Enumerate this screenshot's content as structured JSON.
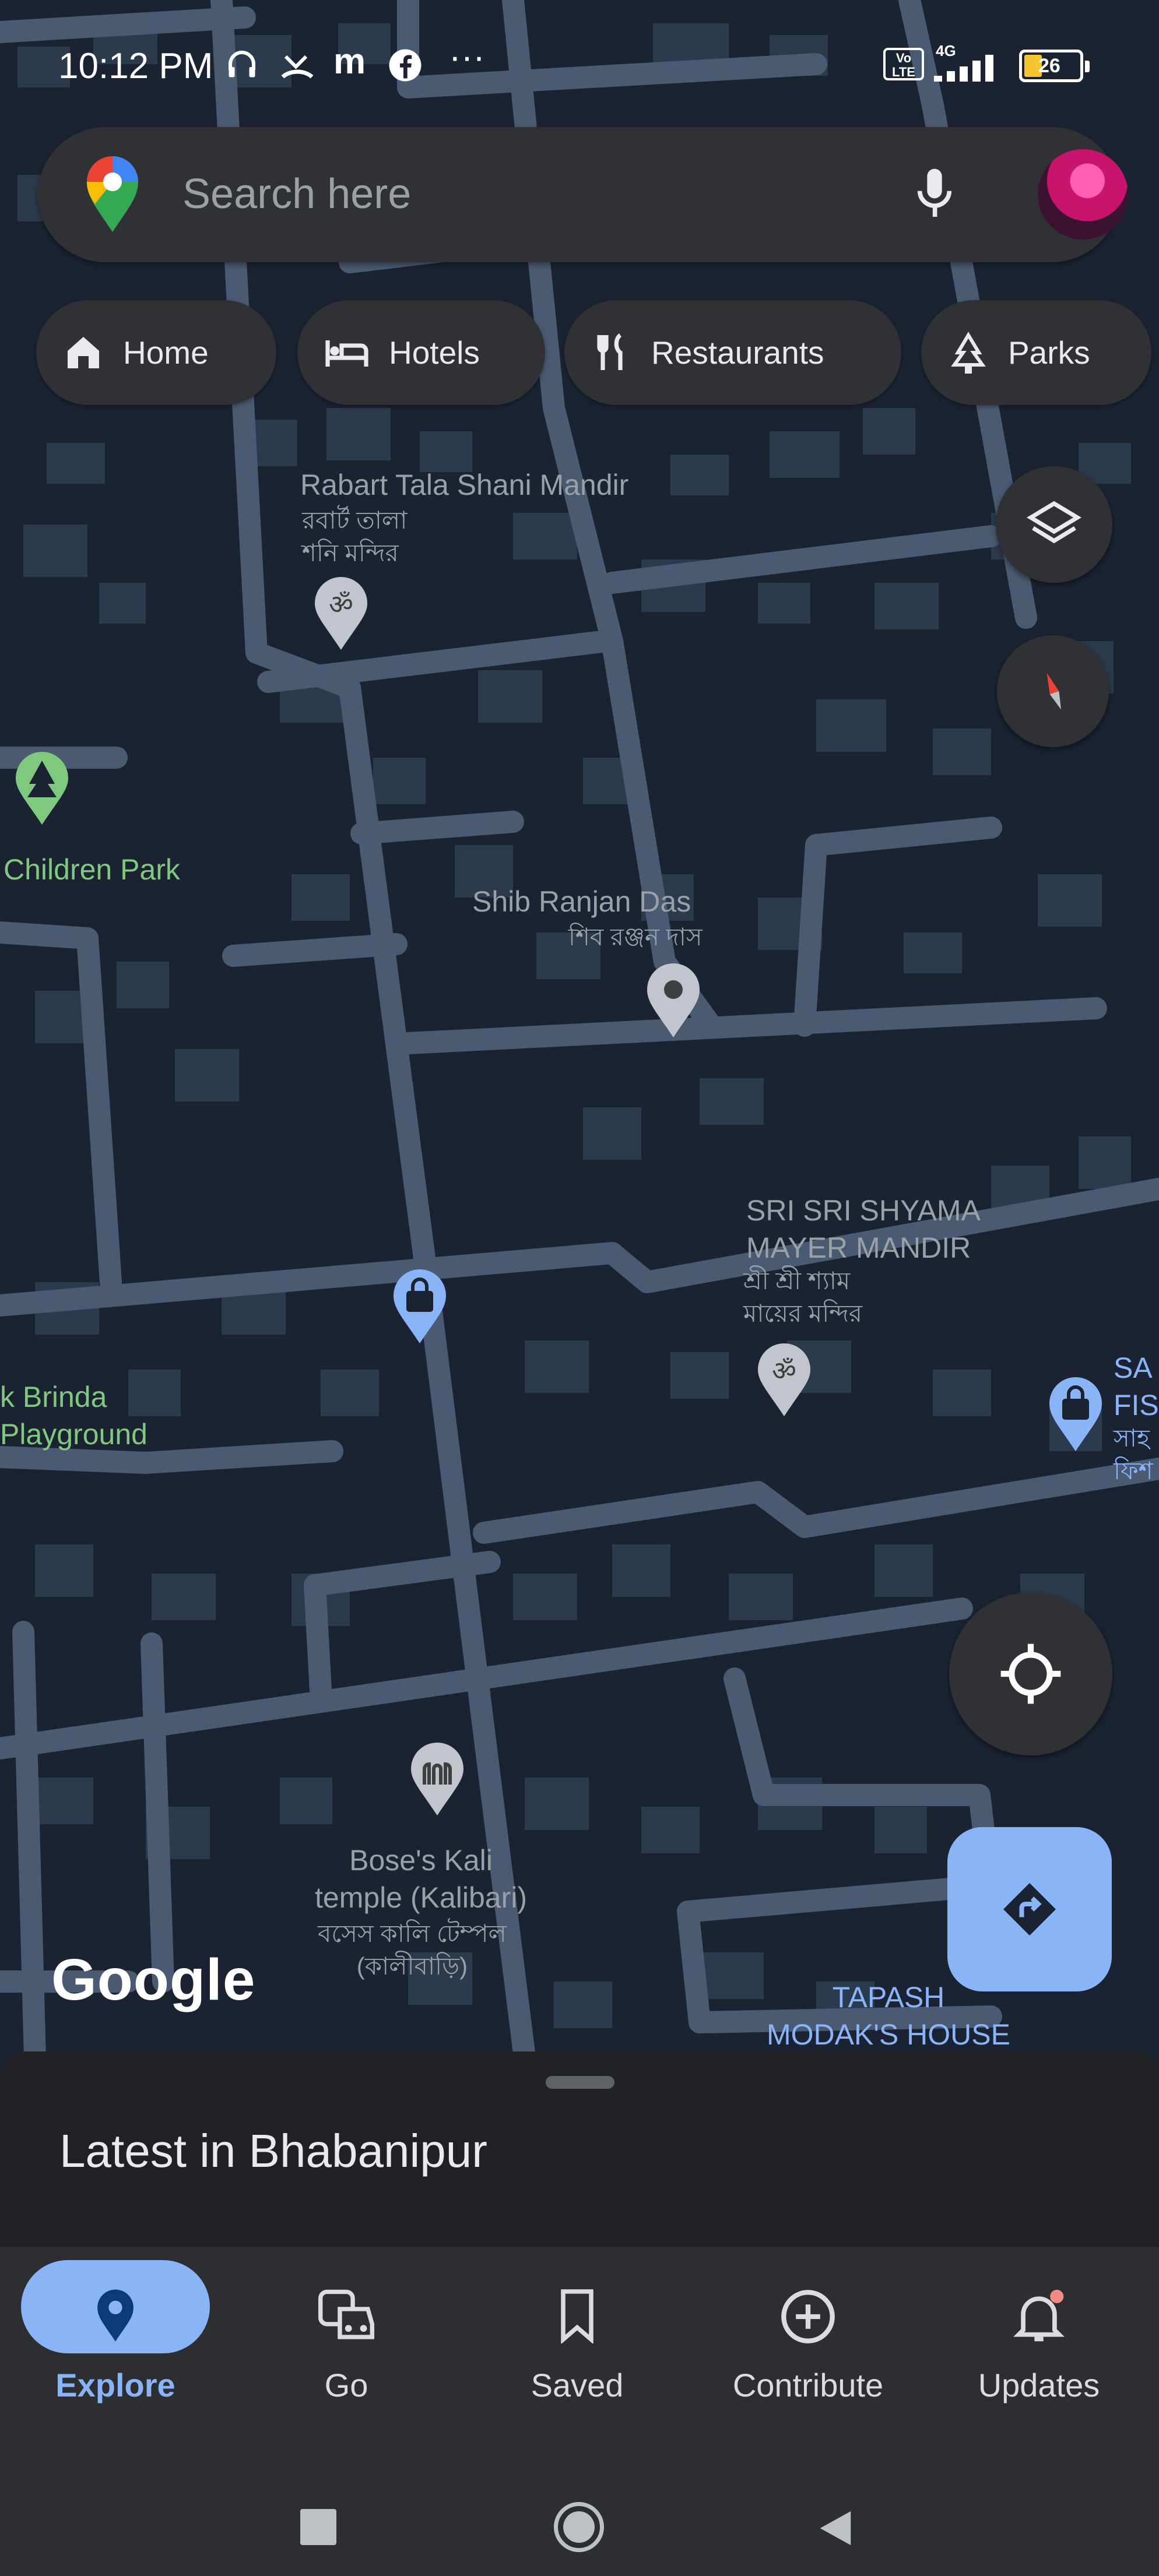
{
  "status_bar": {
    "time": "10:12 PM",
    "battery": "26",
    "network": "4G",
    "volte": "Vo LTE",
    "more": "···"
  },
  "search": {
    "placeholder": "Search here"
  },
  "chips": [
    {
      "label": "Home",
      "icon": "home-icon"
    },
    {
      "label": "Hotels",
      "icon": "hotel-icon"
    },
    {
      "label": "Restaurants",
      "icon": "restaurant-icon"
    },
    {
      "label": "Parks",
      "icon": "park-icon"
    }
  ],
  "map": {
    "labels": {
      "rabart_en": "Rabart Tala Shani Mandir",
      "rabart_bn": "রবার্ট তালা\nশনি মন্দির",
      "children_park": "Children Park",
      "shib_en": "Shib Ranjan Das",
      "shib_bn": "শিব রঞ্জন দাস",
      "shyama_en": "SRI SRI SHYAMA\nMAYER MANDIR",
      "shyama_bn": "শ্রী শ্রী শ্যাম\nমায়ের মন্দির",
      "brinda": "k Brinda\nPlayground",
      "bose_en": "Bose's Kali\ntemple (Kalibari)",
      "bose_bn": "বসেস কালি টেম্পল\n(কালীবাড়ি)",
      "tapash": "TAPASH\nMODAK'S HOUSE",
      "sa_fis": "SA\nFIS",
      "edge_bn": "সাহ\nফিশ"
    },
    "logo": "Google"
  },
  "sheet": {
    "title": "Latest in Bhabanipur"
  },
  "nav": [
    {
      "label": "Explore",
      "icon": "explore-pin-icon"
    },
    {
      "label": "Go",
      "icon": "commute-icon"
    },
    {
      "label": "Saved",
      "icon": "bookmark-icon"
    },
    {
      "label": "Contribute",
      "icon": "add-circle-icon"
    },
    {
      "label": "Updates",
      "icon": "bell-icon"
    }
  ],
  "colors": {
    "map_bg": "#1b2332",
    "road": "#4a5a72",
    "building": "#2c3a4e",
    "accent": "#8ab4f8",
    "surface": "#303134"
  }
}
